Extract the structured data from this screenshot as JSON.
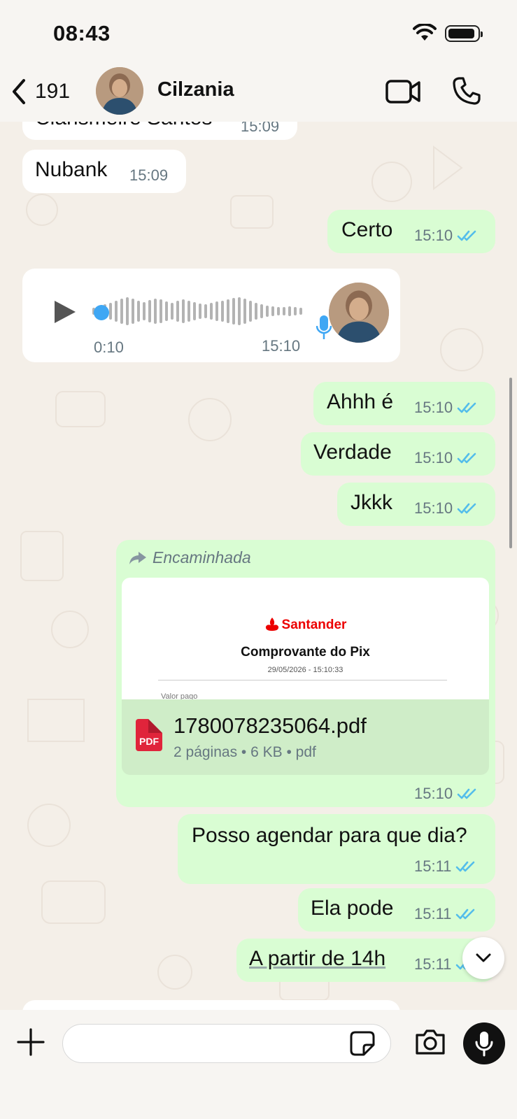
{
  "status_bar": {
    "time": "08:43"
  },
  "header": {
    "back_count": "191",
    "contact_name": "Cilzania"
  },
  "messages": {
    "m0": {
      "text": "Clarismeire Santos",
      "time": "15:09"
    },
    "m1": {
      "text": "Nubank",
      "time": "15:09"
    },
    "m2": {
      "text": "Certo",
      "time": "15:10"
    },
    "voice": {
      "duration": "0:10",
      "time": "15:10",
      "progress": 0
    },
    "m3": {
      "text": "Ahhh é",
      "time": "15:10"
    },
    "m4": {
      "text": "Verdade",
      "time": "15:10"
    },
    "m5": {
      "text": "Jkkk",
      "time": "15:10"
    },
    "doc": {
      "forwarded_label": "Encaminhada",
      "brand": "Santander",
      "preview_title": "Comprovante do Pix",
      "preview_date": "29/05/2026 - 15:10:33",
      "preview_cut_text": "Valor pago",
      "icon_label": "PDF",
      "file_name": "1780078235064.pdf",
      "file_meta": "2 páginas • 6 KB • pdf",
      "time": "15:10"
    },
    "m6": {
      "text": "Posso agendar para que dia?",
      "time": "15:11"
    },
    "m7": {
      "text": "Ela pode",
      "time": "15:11"
    },
    "m8": {
      "text": "A partir de 14h",
      "time": "15:11"
    }
  },
  "input": {
    "placeholder": "",
    "value": ""
  },
  "colors": {
    "outgoing_bubble": "#d9fdd3",
    "incoming_bubble": "#ffffff",
    "read_ticks": "#53bdeb",
    "background": "#f4efe8",
    "voice_progress": "#3fa7f4"
  },
  "icons": [
    "back-chevron-icon",
    "video-call-icon",
    "phone-icon",
    "play-icon",
    "mic-icon",
    "forward-icon",
    "pdf-icon",
    "read-ticks-icon",
    "chevron-down-icon",
    "plus-icon",
    "sticker-icon",
    "camera-icon"
  ]
}
